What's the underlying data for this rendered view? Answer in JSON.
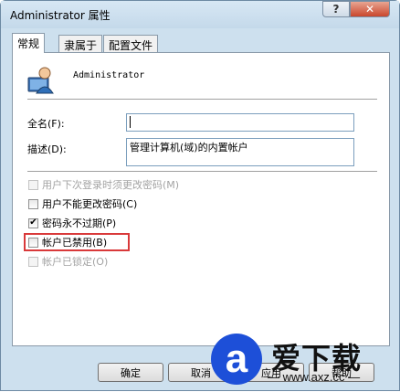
{
  "window": {
    "title": "Administrator 属性",
    "help_label": "?",
    "close_label": "✕"
  },
  "tabs": [
    {
      "label": "常规",
      "active": true
    },
    {
      "label": "隶属于",
      "active": false
    },
    {
      "label": "配置文件",
      "active": false
    }
  ],
  "general": {
    "user_name": "Administrator",
    "full_name_label": "全名(F):",
    "full_name_value": "",
    "description_label": "描述(D):",
    "description_value": "管理计算机(域)的内置帐户"
  },
  "checkboxes": [
    {
      "label": "用户下次登录时须更改密码(M)",
      "checked": false,
      "enabled": false
    },
    {
      "label": "用户不能更改密码(C)",
      "checked": false,
      "enabled": true
    },
    {
      "label": "密码永不过期(P)",
      "checked": true,
      "enabled": true
    },
    {
      "label": "帐户已禁用(B)",
      "checked": false,
      "enabled": true
    },
    {
      "label": "帐户已锁定(O)",
      "checked": false,
      "enabled": false
    }
  ],
  "buttons": {
    "ok": "确定",
    "cancel": "取消",
    "apply": "应用",
    "help": "帮助"
  },
  "watermark": {
    "logo_glyph": "a",
    "text": "爱下载",
    "url": "— www.axz.cc —"
  },
  "colors": {
    "highlight_border": "#d9393a",
    "watermark_blue": "#1d4fd8"
  }
}
